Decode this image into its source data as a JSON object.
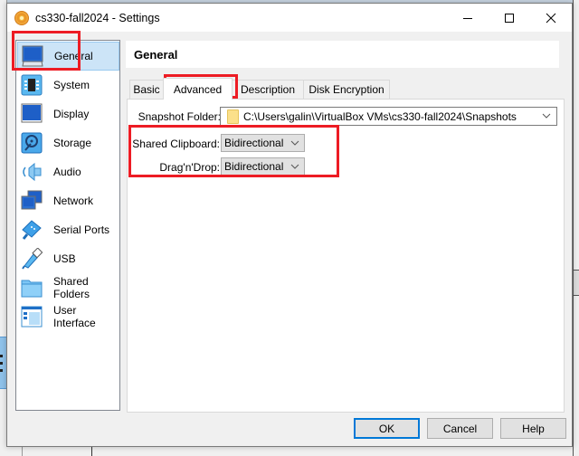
{
  "window": {
    "title": "cs330-fall2024 - Settings",
    "icon": "virtualbox-gear-icon",
    "controls": [
      "minimize",
      "maximize",
      "close"
    ]
  },
  "sidebar": {
    "selected": "General",
    "items": [
      {
        "label": "General",
        "icon": "general-monitor-icon"
      },
      {
        "label": "System",
        "icon": "system-chip-icon"
      },
      {
        "label": "Display",
        "icon": "display-monitor-icon"
      },
      {
        "label": "Storage",
        "icon": "storage-disk-icon"
      },
      {
        "label": "Audio",
        "icon": "audio-speaker-icon"
      },
      {
        "label": "Network",
        "icon": "network-icon"
      },
      {
        "label": "Serial Ports",
        "icon": "serial-port-icon"
      },
      {
        "label": "USB",
        "icon": "usb-icon"
      },
      {
        "label": "Shared Folders",
        "icon": "shared-folder-icon"
      },
      {
        "label": "User Interface",
        "icon": "user-interface-icon"
      }
    ]
  },
  "main": {
    "header": "General",
    "tabs": [
      {
        "label": "Basic"
      },
      {
        "label": "Advanced",
        "active": true
      },
      {
        "label": "Description"
      },
      {
        "label": "Disk Encryption"
      }
    ],
    "form": {
      "snapshot_folder": {
        "label": "Snapshot Folder:",
        "value": "C:\\Users\\galin\\VirtualBox VMs\\cs330-fall2024\\Snapshots"
      },
      "shared_clipboard": {
        "label": "Shared Clipboard:",
        "value": "Bidirectional"
      },
      "drag_n_drop": {
        "label": "Drag'n'Drop:",
        "value": "Bidirectional"
      }
    }
  },
  "buttons": {
    "ok": "OK",
    "cancel": "Cancel",
    "help": "Help"
  },
  "annotations": {
    "highlight_color": "#ed1c24"
  }
}
